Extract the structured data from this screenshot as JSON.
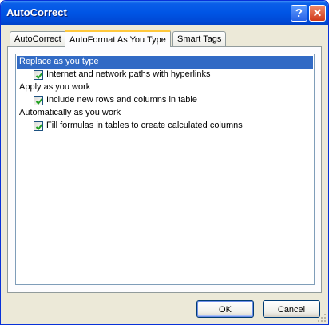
{
  "window": {
    "title": "AutoCorrect",
    "help_glyph": "?",
    "close_glyph": "✕"
  },
  "tabs": [
    {
      "label": "AutoCorrect",
      "active": false
    },
    {
      "label": "AutoFormat As You Type",
      "active": true
    },
    {
      "label": "Smart Tags",
      "active": false
    }
  ],
  "options": {
    "groups": [
      {
        "header": "Replace as you type",
        "selected": true,
        "items": [
          {
            "label": "Internet and network paths with hyperlinks",
            "checked": true
          }
        ]
      },
      {
        "header": "Apply as you work",
        "selected": false,
        "items": [
          {
            "label": "Include new rows and columns in table",
            "checked": true
          }
        ]
      },
      {
        "header": "Automatically as you work",
        "selected": false,
        "items": [
          {
            "label": "Fill formulas in tables to create calculated columns",
            "checked": true
          }
        ]
      }
    ]
  },
  "buttons": {
    "ok_label": "OK",
    "cancel_label": "Cancel"
  },
  "colors": {
    "title_bar": "#0055e5",
    "selection": "#316ac5",
    "active_tab_accent": "#ffc83c",
    "checkmark": "#21a121"
  },
  "icons": {
    "checkbox_mark": "checkmark-icon",
    "help": "help-icon",
    "close": "close-icon"
  }
}
